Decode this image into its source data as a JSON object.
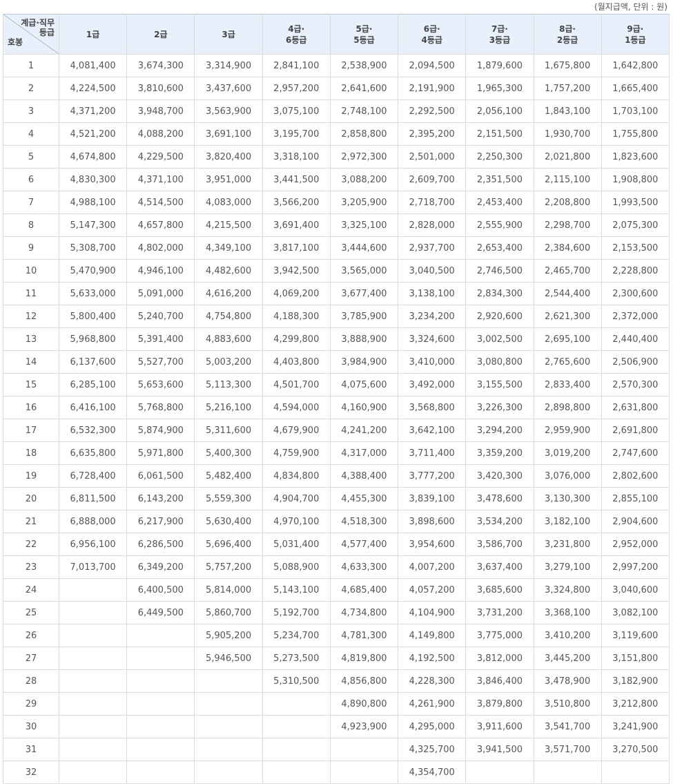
{
  "unit_note": "(월지급액, 단위 : 원)",
  "corner": {
    "top_line1": "계급·직무",
    "top_line2": "등급",
    "bottom": "호봉"
  },
  "columns": [
    [
      "1급"
    ],
    [
      "2급"
    ],
    [
      "3급"
    ],
    [
      "4급·",
      "6등급"
    ],
    [
      "5급·",
      "5등급"
    ],
    [
      "6급·",
      "4등급"
    ],
    [
      "7급·",
      "3등급"
    ],
    [
      "8급·",
      "2등급"
    ],
    [
      "9급·",
      "1등급"
    ]
  ],
  "rows": [
    [
      "1",
      "4,081,400",
      "3,674,300",
      "3,314,900",
      "2,841,100",
      "2,538,900",
      "2,094,500",
      "1,879,600",
      "1,675,800",
      "1,642,800"
    ],
    [
      "2",
      "4,224,500",
      "3,810,600",
      "3,437,600",
      "2,957,200",
      "2,641,600",
      "2,191,900",
      "1,965,300",
      "1,757,200",
      "1,665,400"
    ],
    [
      "3",
      "4,371,200",
      "3,948,700",
      "3,563,900",
      "3,075,100",
      "2,748,100",
      "2,292,500",
      "2,056,100",
      "1,843,100",
      "1,703,100"
    ],
    [
      "4",
      "4,521,200",
      "4,088,200",
      "3,691,100",
      "3,195,700",
      "2,858,800",
      "2,395,200",
      "2,151,500",
      "1,930,700",
      "1,755,800"
    ],
    [
      "5",
      "4,674,800",
      "4,229,500",
      "3,820,400",
      "3,318,100",
      "2,972,300",
      "2,501,000",
      "2,250,300",
      "2,021,800",
      "1,823,600"
    ],
    [
      "6",
      "4,830,300",
      "4,371,100",
      "3,951,000",
      "3,441,500",
      "3,088,200",
      "2,609,700",
      "2,351,500",
      "2,115,100",
      "1,908,800"
    ],
    [
      "7",
      "4,988,100",
      "4,514,500",
      "4,083,000",
      "3,566,200",
      "3,205,900",
      "2,718,700",
      "2,453,400",
      "2,208,800",
      "1,993,500"
    ],
    [
      "8",
      "5,147,300",
      "4,657,800",
      "4,215,500",
      "3,691,400",
      "3,325,100",
      "2,828,000",
      "2,555,900",
      "2,298,700",
      "2,075,300"
    ],
    [
      "9",
      "5,308,700",
      "4,802,000",
      "4,349,100",
      "3,817,100",
      "3,444,600",
      "2,937,700",
      "2,653,400",
      "2,384,600",
      "2,153,500"
    ],
    [
      "10",
      "5,470,900",
      "4,946,100",
      "4,482,600",
      "3,942,500",
      "3,565,000",
      "3,040,500",
      "2,746,500",
      "2,465,700",
      "2,228,800"
    ],
    [
      "11",
      "5,633,000",
      "5,091,000",
      "4,616,200",
      "4,069,200",
      "3,677,400",
      "3,138,100",
      "2,834,300",
      "2,544,400",
      "2,300,600"
    ],
    [
      "12",
      "5,800,400",
      "5,240,700",
      "4,754,800",
      "4,188,300",
      "3,785,900",
      "3,234,200",
      "2,920,600",
      "2,621,300",
      "2,372,000"
    ],
    [
      "13",
      "5,968,800",
      "5,391,400",
      "4,883,600",
      "4,299,800",
      "3,888,900",
      "3,324,600",
      "3,002,500",
      "2,695,100",
      "2,440,400"
    ],
    [
      "14",
      "6,137,600",
      "5,527,700",
      "5,003,200",
      "4,403,800",
      "3,984,900",
      "3,410,000",
      "3,080,800",
      "2,765,600",
      "2,506,900"
    ],
    [
      "15",
      "6,285,100",
      "5,653,600",
      "5,113,300",
      "4,501,700",
      "4,075,600",
      "3,492,000",
      "3,155,500",
      "2,833,400",
      "2,570,300"
    ],
    [
      "16",
      "6,416,100",
      "5,768,800",
      "5,216,100",
      "4,594,000",
      "4,160,900",
      "3,568,800",
      "3,226,300",
      "2,898,800",
      "2,631,800"
    ],
    [
      "17",
      "6,532,300",
      "5,874,900",
      "5,311,600",
      "4,679,900",
      "4,241,200",
      "3,642,100",
      "3,294,200",
      "2,959,900",
      "2,691,800"
    ],
    [
      "18",
      "6,635,800",
      "5,971,800",
      "5,400,300",
      "4,759,900",
      "4,317,000",
      "3,711,400",
      "3,359,200",
      "3,019,200",
      "2,747,600"
    ],
    [
      "19",
      "6,728,400",
      "6,061,500",
      "5,482,400",
      "4,834,800",
      "4,388,400",
      "3,777,200",
      "3,420,300",
      "3,076,000",
      "2,802,600"
    ],
    [
      "20",
      "6,811,500",
      "6,143,200",
      "5,559,300",
      "4,904,700",
      "4,455,300",
      "3,839,100",
      "3,478,600",
      "3,130,300",
      "2,855,100"
    ],
    [
      "21",
      "6,888,000",
      "6,217,900",
      "5,630,400",
      "4,970,100",
      "4,518,300",
      "3,898,600",
      "3,534,200",
      "3,182,100",
      "2,904,600"
    ],
    [
      "22",
      "6,956,100",
      "6,286,500",
      "5,696,400",
      "5,031,400",
      "4,577,400",
      "3,954,600",
      "3,586,700",
      "3,231,800",
      "2,952,000"
    ],
    [
      "23",
      "7,013,700",
      "6,349,200",
      "5,757,200",
      "5,088,900",
      "4,633,300",
      "4,007,200",
      "3,637,400",
      "3,279,100",
      "2,997,200"
    ],
    [
      "24",
      "",
      "6,400,500",
      "5,814,000",
      "5,143,100",
      "4,685,400",
      "4,057,200",
      "3,685,600",
      "3,324,800",
      "3,040,600"
    ],
    [
      "25",
      "",
      "6,449,500",
      "5,860,700",
      "5,192,700",
      "4,734,800",
      "4,104,900",
      "3,731,200",
      "3,368,100",
      "3,082,100"
    ],
    [
      "26",
      "",
      "",
      "5,905,200",
      "5,234,700",
      "4,781,300",
      "4,149,800",
      "3,775,000",
      "3,410,200",
      "3,119,600"
    ],
    [
      "27",
      "",
      "",
      "5,946,500",
      "5,273,500",
      "4,819,800",
      "4,192,500",
      "3,812,000",
      "3,445,200",
      "3,151,800"
    ],
    [
      "28",
      "",
      "",
      "",
      "5,310,500",
      "4,856,800",
      "4,228,300",
      "3,846,400",
      "3,478,900",
      "3,182,900"
    ],
    [
      "29",
      "",
      "",
      "",
      "",
      "4,890,800",
      "4,261,900",
      "3,879,800",
      "3,510,800",
      "3,212,800"
    ],
    [
      "30",
      "",
      "",
      "",
      "",
      "4,923,900",
      "4,295,000",
      "3,911,600",
      "3,541,700",
      "3,241,900"
    ],
    [
      "31",
      "",
      "",
      "",
      "",
      "",
      "4,325,700",
      "3,941,500",
      "3,571,700",
      "3,270,500"
    ],
    [
      "32",
      "",
      "",
      "",
      "",
      "",
      "4,354,700",
      "",
      "",
      ""
    ]
  ]
}
